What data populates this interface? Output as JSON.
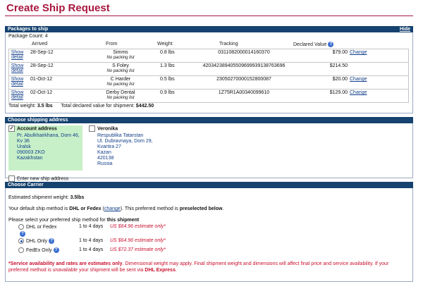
{
  "page": {
    "title": "Create Ship Request"
  },
  "packages": {
    "header": "Packages to ship",
    "hide_label": "Hide",
    "count_text": "Package Count: 4",
    "columns": {
      "arrived": "Arrived",
      "from": "From",
      "weight": "Weight",
      "tracking": "Tracking",
      "declared": "Declared Value"
    },
    "show_label": "Show detail",
    "change_label": "Change",
    "rows": [
      {
        "arrived": "28-Sep-12",
        "from": "Simms",
        "note": "No packing list",
        "weight": "0.8 lbs",
        "tracking": "0311082000014160370",
        "value": "$79.00",
        "has_change": true
      },
      {
        "arrived": "28-Sep-12",
        "from": "S Foley",
        "note": "No packing list",
        "weight": "1.3 lbs",
        "tracking": "420342389405509699939138763696",
        "value": "$214.50",
        "has_change": false
      },
      {
        "arrived": "01-Oct-12",
        "from": "C Harder",
        "note": "No packing list",
        "weight": "0.5 lbs",
        "tracking": "23050270000152800087",
        "value": "$20.00",
        "has_change": true
      },
      {
        "arrived": "02-Oct-12",
        "from": "Derby Dental",
        "note": "No packing list",
        "weight": "0.9 lbs",
        "tracking": "1Z75R1A00340099610",
        "value": "$129.00",
        "has_change": true
      }
    ],
    "total_weight_label": "Total weight:",
    "total_weight": "3.5 lbs",
    "total_value_label": "Total declared value for shipment:",
    "total_value": "$442.50"
  },
  "shipping": {
    "header": "Choose shipping address",
    "account": {
      "title": "Account address",
      "checked": true,
      "lines": [
        "Pr. Abulkhairkhana, Dom 46,",
        "Kv 36",
        "Uralsk",
        "090003 ZKO",
        "Kazakhstan"
      ]
    },
    "alt": {
      "title": "Veronika",
      "checked": false,
      "lines": [
        "Respublika Tatarstan",
        "Ul. Dubravnaya, Dom 29,",
        "Kvartira 27",
        "Kazan",
        "420138",
        "Russia"
      ]
    },
    "enter_new": "Enter new ship address"
  },
  "carrier": {
    "header": "Choose Carrier",
    "estimated_prefix": "Estimated shipment weight:",
    "estimated_weight": "3.5lbs",
    "default_prefix": "Your default ship method is",
    "default_method": "DHL or Fedex",
    "change_link": "change",
    "default_suffix": "This preferred method is",
    "preselected": "preselected below",
    "select_prefix": "Please select your preferred ship method for",
    "select_bold": "this shipment",
    "options": [
      {
        "label": "DHL or Fedex",
        "days": "1 to 4 days",
        "price": "US $64.96 estimate only*",
        "selected": false
      },
      {
        "label": "DHL Only",
        "days": "1 to 4 days",
        "price": "US $64.96 estimate only*",
        "selected": true
      },
      {
        "label": "FedEx Only",
        "days": "1 to 4 days",
        "price": "US $72.37 estimate only*",
        "selected": false
      }
    ],
    "disclaimer_bold": "*Service availability and rates are estimates only",
    "disclaimer_text": ". Dimensional weight may apply. Final shipment weight and dimensions will affect final price and service availability. If your preferred method is unavailable your shipment will be sent via ",
    "disclaimer_dhl": "DHL Express"
  },
  "icons": {
    "help": "help-circle-icon",
    "checkbox": "checkbox-icon",
    "radio": "radio-icon"
  },
  "colors": {
    "title": "#a8173f",
    "bar": "#15426f",
    "link": "#123f8a",
    "warning": "#c8102e",
    "address_bg": "#c8f0c8"
  }
}
